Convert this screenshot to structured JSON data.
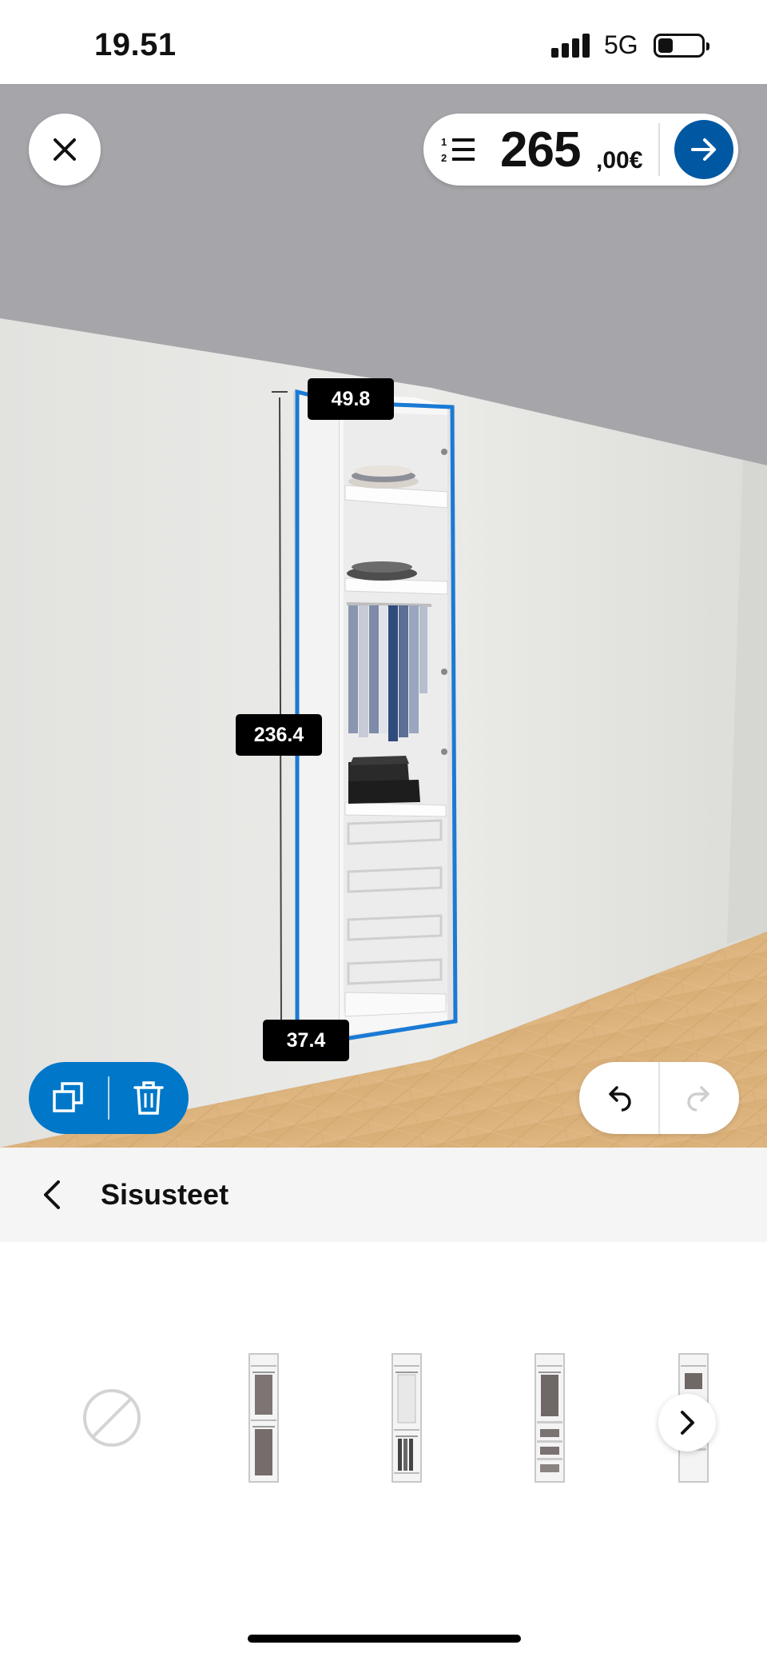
{
  "status_bar": {
    "time": "19.51",
    "network": "5G",
    "battery_level": 0.35
  },
  "toolbar": {
    "close_icon": "close-icon",
    "list_icon": "numbered-list-icon",
    "price_integer": "265",
    "price_decimal": ",00€",
    "next_icon": "arrow-right-icon",
    "accent_color": "#0058a3"
  },
  "dimensions": {
    "width": "49.8",
    "height": "236.4",
    "depth": "37.4"
  },
  "scene_actions": {
    "copy_icon": "duplicate-icon",
    "delete_icon": "trash-icon",
    "undo_icon": "undo-icon",
    "redo_icon": "redo-icon",
    "action_color": "#0077c8"
  },
  "section": {
    "back_icon": "chevron-left-icon",
    "title": "Sisusteet"
  },
  "options": {
    "items": [
      {
        "icon": "none-icon"
      },
      {
        "icon": "interior-option-1"
      },
      {
        "icon": "interior-option-2"
      },
      {
        "icon": "interior-option-3"
      },
      {
        "icon": "interior-option-4"
      }
    ],
    "scroll_icon": "chevron-right-icon"
  }
}
